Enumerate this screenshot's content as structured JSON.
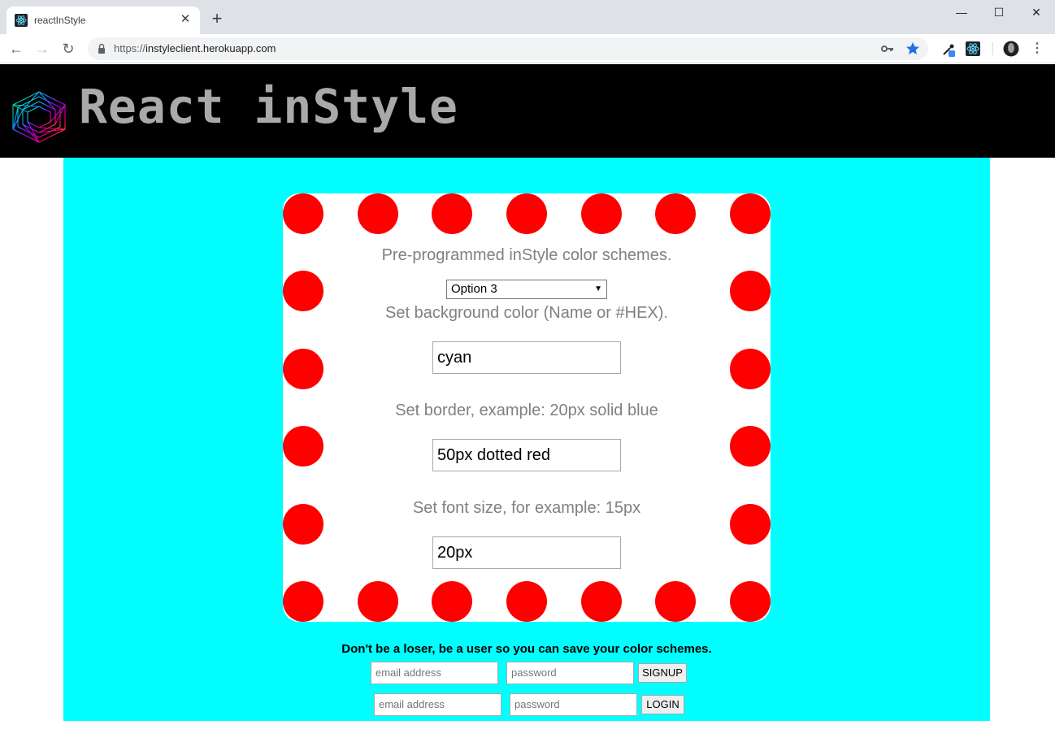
{
  "browser": {
    "tab_title": "reactInStyle",
    "url_scheme": "https://",
    "url_host": "instyleclient.herokuapp.com"
  },
  "site": {
    "title": "React inStyle"
  },
  "card": {
    "scheme_label": "Pre-programmed inStyle color schemes.",
    "scheme_selected": "Option 3",
    "bg_label": "Set background color (Name or #HEX).",
    "bg_value": "cyan",
    "border_label": "Set border, example: 20px solid blue",
    "border_value": "50px dotted red",
    "font_label": "Set font size, for example: 15px",
    "font_value": "20px"
  },
  "auth": {
    "message": "Don't be a loser, be a user so you can save your color schemes.",
    "signup_email_placeholder": "email address",
    "signup_password_placeholder": "password",
    "signup_button": "SIGNUP",
    "login_email_placeholder": "email address",
    "login_password_placeholder": "password",
    "login_button": "LOGIN"
  },
  "colors": {
    "page_background": "#00ffff",
    "border_dots": "#ff0000",
    "header_background": "#000000",
    "title_text": "#a9a9a9"
  }
}
